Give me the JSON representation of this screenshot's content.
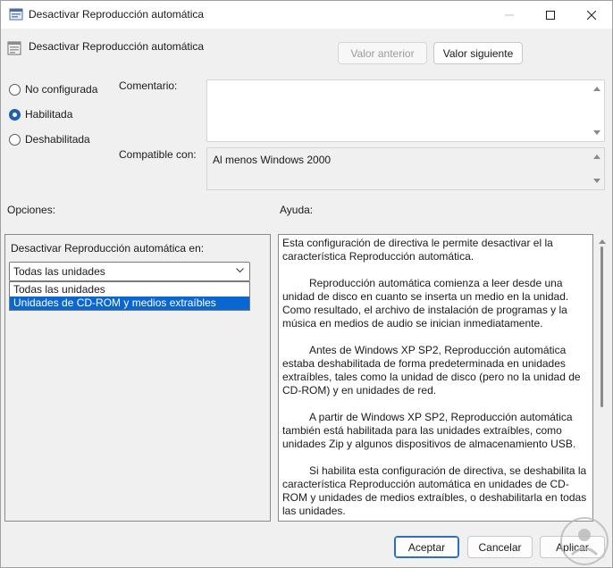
{
  "window": {
    "title": "Desactivar Reproducción automática",
    "buttons": [
      "minimize",
      "maximize",
      "close"
    ]
  },
  "header": {
    "policy_name": "Desactivar Reproducción automática",
    "prev_label": "Valor anterior",
    "next_label": "Valor siguiente"
  },
  "state": {
    "options": [
      {
        "label": "No configurada",
        "checked": false
      },
      {
        "label": "Habilitada",
        "checked": true
      },
      {
        "label": "Deshabilitada",
        "checked": false
      }
    ]
  },
  "comment": {
    "label": "Comentario:",
    "value": ""
  },
  "compat": {
    "label": "Compatible con:",
    "value": "Al menos Windows 2000"
  },
  "options_panel": {
    "heading": "Opciones:",
    "field_label": "Desactivar Reproducción automática en:",
    "selected": "Todas las unidades",
    "dropdown": [
      "Todas las unidades",
      "Unidades de CD-ROM y medios extraíbles"
    ],
    "highlighted_index": 1
  },
  "help_panel": {
    "heading": "Ayuda:",
    "paragraphs": [
      "Esta configuración de directiva le permite desactivar el la característica Reproducción automática.",
      "Reproducción automática comienza a leer desde una unidad de disco en cuanto se inserta un medio en la unidad. Como resultado, el archivo de instalación de programas y la música en medios de audio se inician inmediatamente.",
      "Antes de Windows XP SP2, Reproducción automática estaba deshabilitada de forma predeterminada en unidades extraíbles, tales como la unidad de disco (pero no la unidad de CD-ROM) y en unidades de red.",
      "A partir de Windows XP SP2, Reproducción automática también está habilitada para las unidades extraíbles, como unidades Zip y algunos dispositivos de almacenamiento USB.",
      "Si habilita esta configuración de directiva, se deshabilita la característica Reproducción automática en unidades de CD-ROM y unidades de medios extraíbles, o deshabilitarla en todas las unidades."
    ]
  },
  "footer": {
    "ok_label": "Aceptar",
    "cancel_label": "Cancelar",
    "apply_label": "Aplicar"
  },
  "colors": {
    "accent": "#1f5fb4",
    "selection": "#0a66d0",
    "background": "#f0f0f0"
  }
}
